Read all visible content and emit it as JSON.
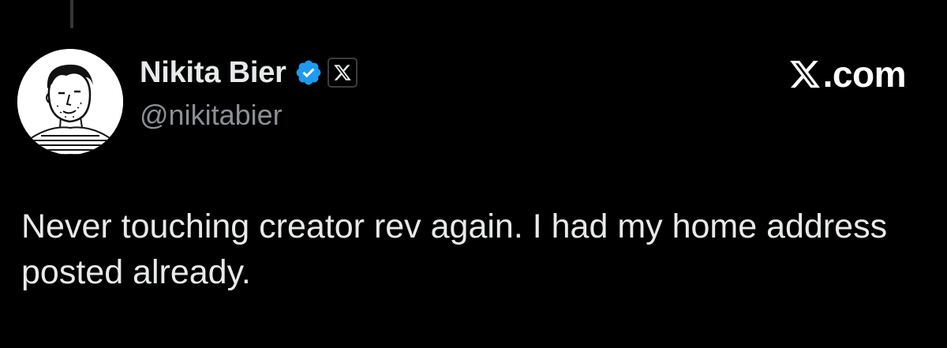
{
  "author": {
    "display_name": "Nikita Bier",
    "handle": "@nikitabier",
    "verified": true,
    "affiliate_badge_icon": "x-logo-icon",
    "avatar_icon": "avatar-sketch-portrait"
  },
  "brand": {
    "logo_icon": "x-logo-icon",
    "suffix": ".com"
  },
  "tweet": {
    "text": "Never touching creator rev again. I had my home address posted already."
  },
  "colors": {
    "background": "#000000",
    "primary_text": "#e7e9ea",
    "secondary_text": "#8b9096",
    "verified_blue": "#1d9bf0"
  }
}
